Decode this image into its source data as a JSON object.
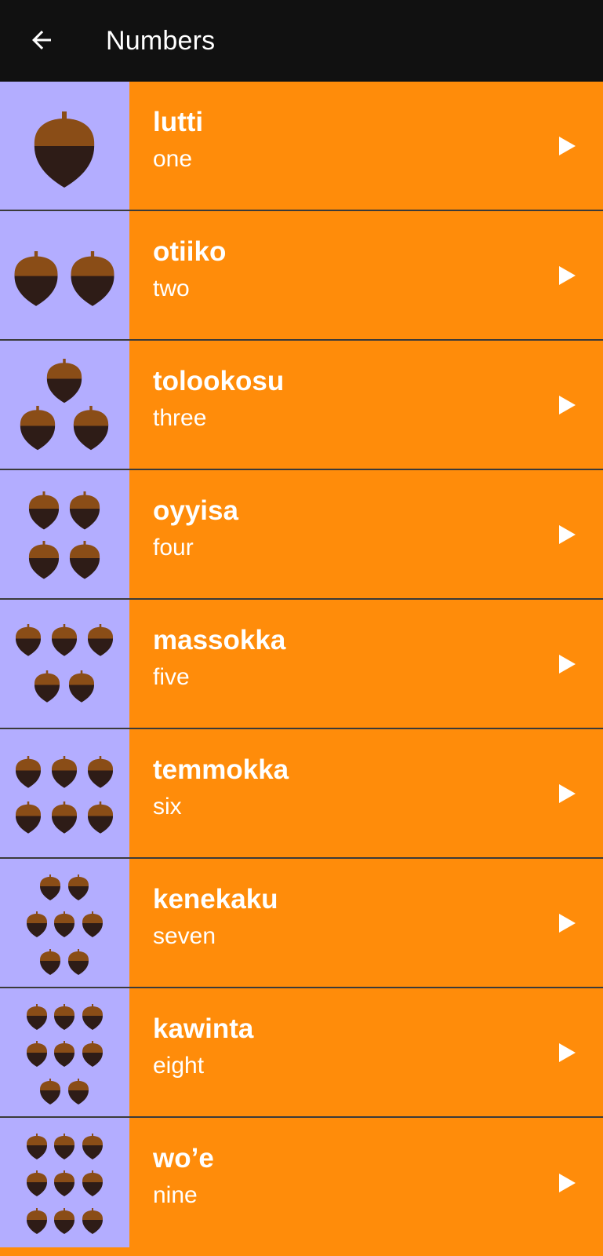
{
  "app_bar": {
    "title": "Numbers",
    "back_icon": "arrow-left-icon"
  },
  "colors": {
    "app_bar_bg": "#111111",
    "row_bg": "#ff8c0a",
    "image_bg": "#b3adff",
    "acorn_cap": "#8a4d17",
    "acorn_body": "#2e1c17",
    "text": "#ffffff"
  },
  "items": [
    {
      "word": "lutti",
      "translation": "one",
      "count": 1,
      "icon": "acorn-icon",
      "action_icon": "play-icon"
    },
    {
      "word": "otiiko",
      "translation": "two",
      "count": 2,
      "icon": "acorn-icon",
      "action_icon": "play-icon"
    },
    {
      "word": "tolookosu",
      "translation": "three",
      "count": 3,
      "icon": "acorn-icon",
      "action_icon": "play-icon"
    },
    {
      "word": "oyyisa",
      "translation": "four",
      "count": 4,
      "icon": "acorn-icon",
      "action_icon": "play-icon"
    },
    {
      "word": "massokka",
      "translation": "five",
      "count": 5,
      "icon": "acorn-icon",
      "action_icon": "play-icon"
    },
    {
      "word": "temmokka",
      "translation": "six",
      "count": 6,
      "icon": "acorn-icon",
      "action_icon": "play-icon"
    },
    {
      "word": "kenekaku",
      "translation": "seven",
      "count": 7,
      "icon": "acorn-icon",
      "action_icon": "play-icon"
    },
    {
      "word": "kawinta",
      "translation": "eight",
      "count": 8,
      "icon": "acorn-icon",
      "action_icon": "play-icon"
    },
    {
      "word": "wo’e",
      "translation": "nine",
      "count": 9,
      "icon": "acorn-icon",
      "action_icon": "play-icon"
    }
  ]
}
